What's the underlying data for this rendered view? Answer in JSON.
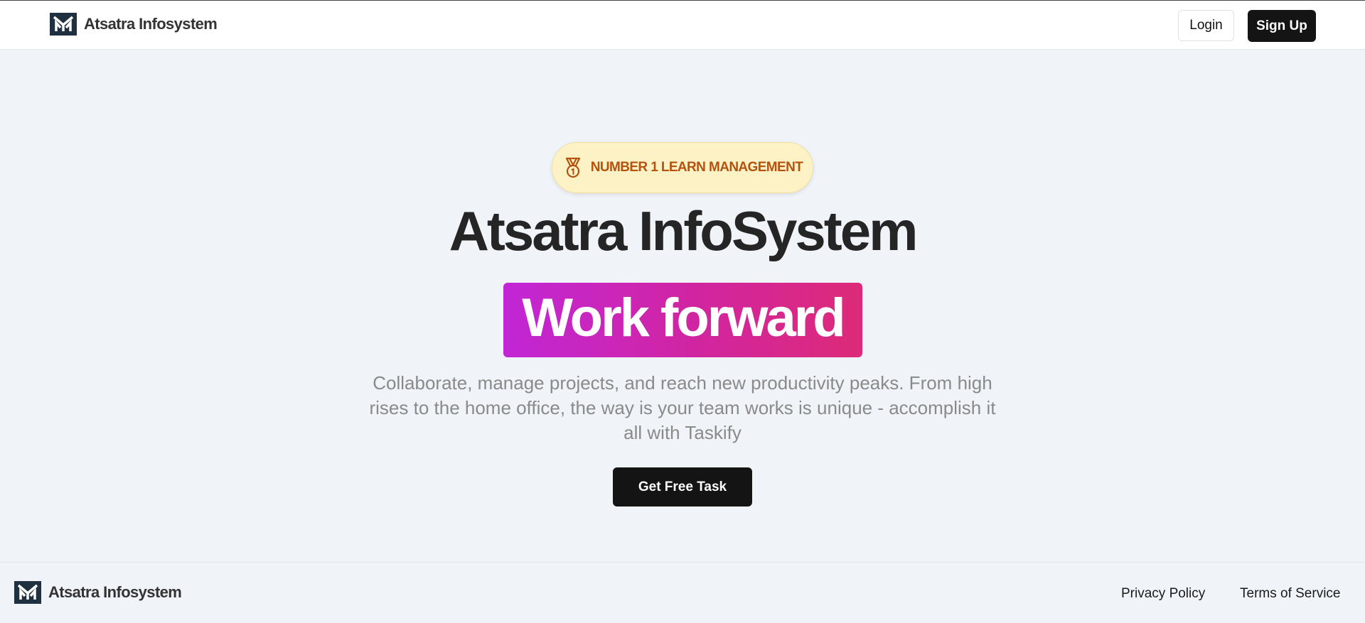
{
  "header": {
    "brand_name": "Atsatra Infosystem",
    "login_label": "Login",
    "signup_label": "Sign Up"
  },
  "hero": {
    "badge_text": "Number 1 Learn Management",
    "badge_icon": "medal-icon",
    "title": "Atsatra InfoSystem",
    "highlight": "Work forward",
    "subtitle": "Collaborate, manage projects, and reach new productivity peaks. From high rises to the home office, the way is your team works is unique - accomplish it all with Taskify",
    "cta_label": "Get Free Task"
  },
  "footer": {
    "brand_name": "Atsatra Infosystem",
    "links": [
      {
        "label": "Privacy Policy"
      },
      {
        "label": "Terms of Service"
      }
    ]
  },
  "colors": {
    "background": "#f0f3f7",
    "badge_bg": "#fdf2c6",
    "badge_text": "#b4530e",
    "gradient_start": "#c126d6",
    "gradient_end": "#dd2a78",
    "button_dark": "#141414",
    "logo_bg": "#1f3140"
  }
}
